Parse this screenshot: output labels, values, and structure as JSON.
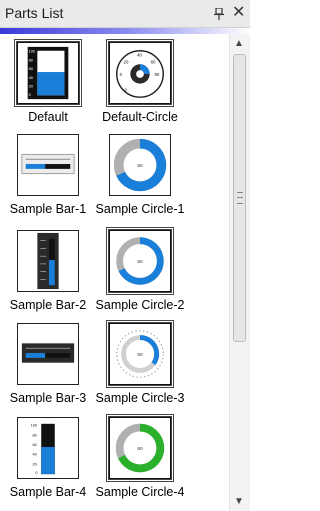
{
  "panel": {
    "title": "Parts List"
  },
  "icons": {
    "pin": "pin-icon",
    "close": "close-icon"
  },
  "colors": {
    "accent": "#3a3ad8",
    "gauge_blue": "#1a7fd8",
    "gauge_green": "#2bb02b",
    "gauge_gray": "#b0b0b0"
  },
  "parts": [
    {
      "label": "Default",
      "type": "vertical-bar-gauge"
    },
    {
      "label": "Default-Circle",
      "type": "dial-gauge"
    },
    {
      "label": "Sample Bar-1",
      "type": "horizontal-bar-gauge"
    },
    {
      "label": "Sample Circle-1",
      "type": "circle-gauge",
      "value": "60"
    },
    {
      "label": "Sample Bar-2",
      "type": "vertical-bar-gauge-dark"
    },
    {
      "label": "Sample Circle-2",
      "type": "circle-gauge",
      "value": "60"
    },
    {
      "label": "Sample Bar-3",
      "type": "horizontal-bar-gauge-dark"
    },
    {
      "label": "Sample Circle-3",
      "type": "circle-gauge-ticks",
      "value": "60"
    },
    {
      "label": "Sample Bar-4",
      "type": "vertical-bar-gauge-white"
    },
    {
      "label": "Sample Circle-4",
      "type": "circle-gauge-green",
      "value": "60"
    }
  ],
  "dial_labels": [
    "20",
    "40",
    "60",
    "80",
    "0",
    "0"
  ],
  "bar_scale": [
    "100",
    "80",
    "60",
    "40",
    "20",
    "0"
  ]
}
